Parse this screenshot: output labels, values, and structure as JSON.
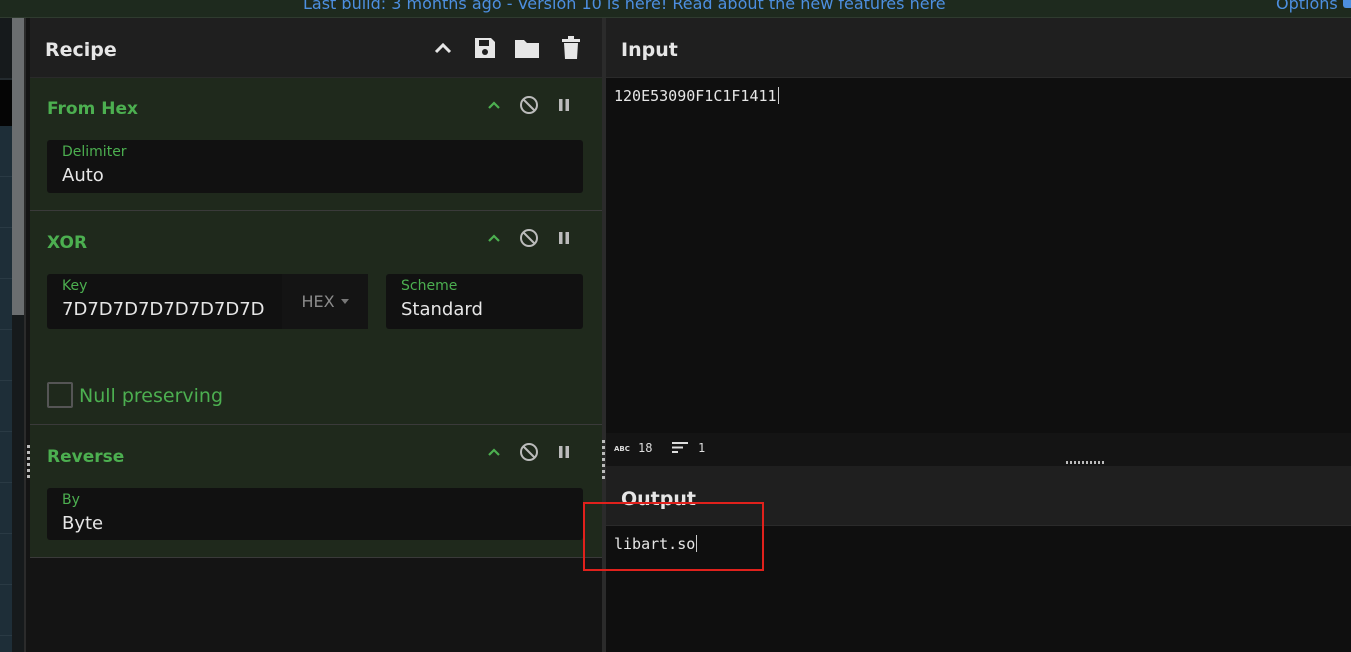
{
  "topbar": {
    "notice": "Last build: 3 months ago - Version 10 is here! Read about the new features here",
    "options": "Options"
  },
  "recipe": {
    "title": "Recipe",
    "icons": [
      "chevron-up-icon",
      "save-icon",
      "folder-icon",
      "trash-icon"
    ],
    "operations": [
      {
        "name": "From Hex",
        "fields": [
          {
            "label": "Delimiter",
            "value": "Auto"
          }
        ]
      },
      {
        "name": "XOR",
        "fields": [
          {
            "label": "Key",
            "value": "7D7D7D7D7D7D7D7D",
            "format": "HEX"
          },
          {
            "label": "Scheme",
            "value": "Standard"
          }
        ],
        "checkbox": {
          "label": "Null preserving",
          "checked": false
        }
      },
      {
        "name": "Reverse",
        "fields": [
          {
            "label": "By",
            "value": "Byte"
          }
        ]
      }
    ]
  },
  "input": {
    "title": "Input",
    "text": "120E53090F1C1F1411",
    "status": {
      "length": "18",
      "lines": "1"
    }
  },
  "output": {
    "title": "Output",
    "text": "libart.so"
  },
  "colors": {
    "accent_green": "#4caf50",
    "link_blue": "#4d8fe0",
    "highlight_red": "#e0211c"
  }
}
